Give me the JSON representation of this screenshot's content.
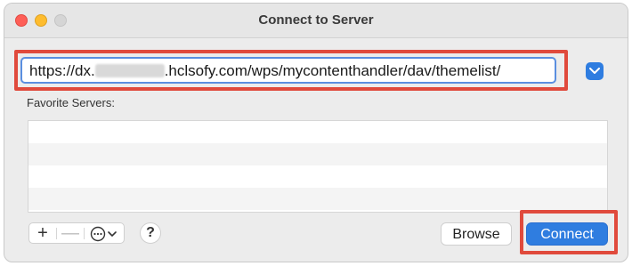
{
  "window": {
    "title": "Connect to Server"
  },
  "server_address": {
    "prefix": "https://dx.",
    "suffix": ".hclsofy.com/wps/mycontenthandler/dav/themelist/"
  },
  "favorites": {
    "label": "Favorite Servers:",
    "rows": [
      "",
      "",
      "",
      ""
    ]
  },
  "toolbar": {
    "add_label": "+",
    "remove_label": "—",
    "help_label": "?"
  },
  "buttons": {
    "browse_label": "Browse",
    "connect_label": "Connect"
  },
  "colors": {
    "highlight_red": "#e04a3c",
    "accent_blue": "#2f7de0"
  }
}
